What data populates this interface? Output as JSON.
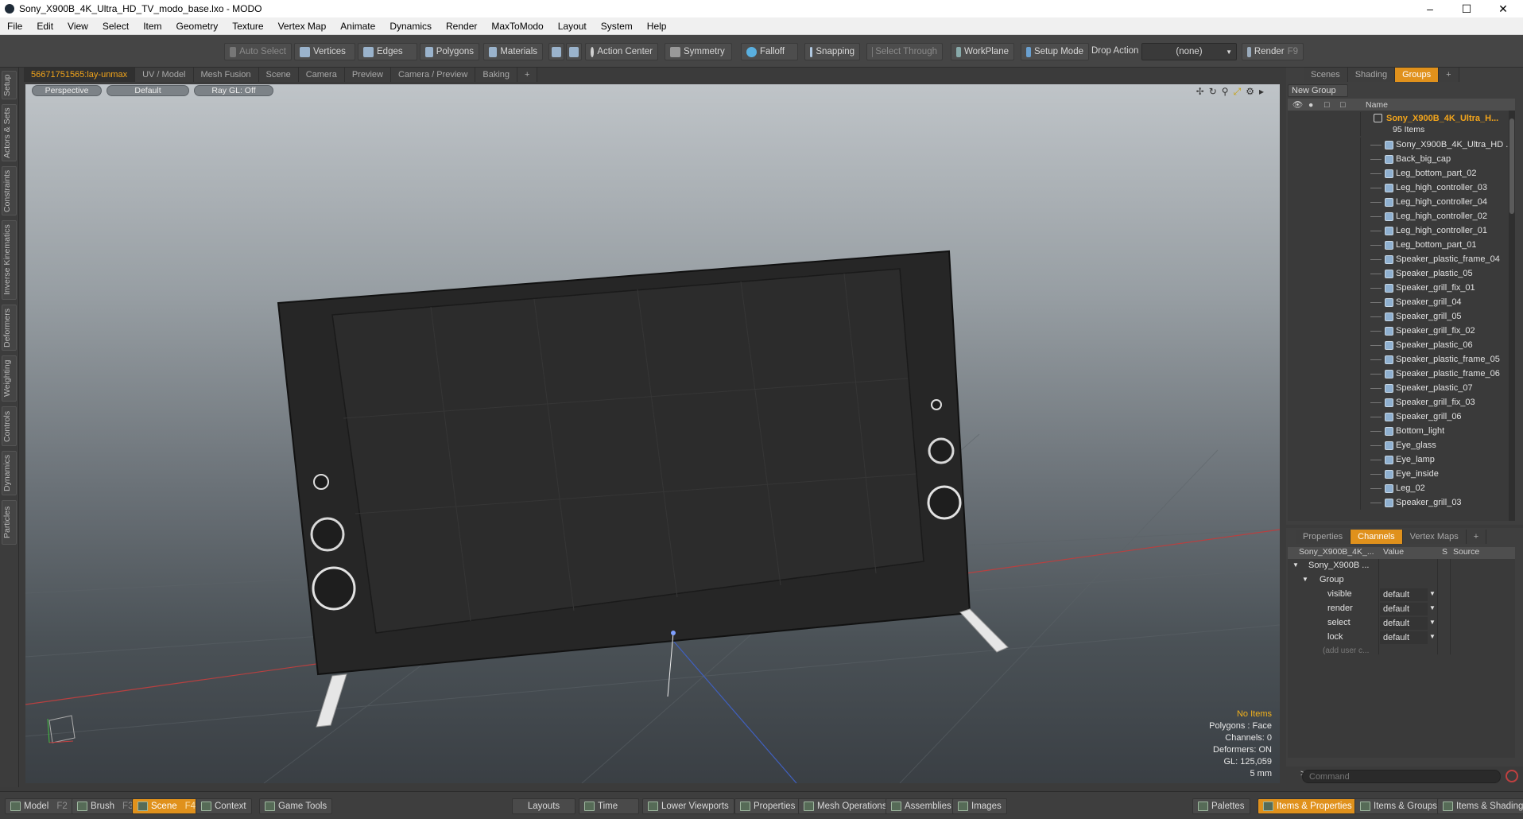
{
  "window": {
    "title": "Sony_X900B_4K_Ultra_HD_TV_modo_base.lxo - MODO",
    "minimize": "–",
    "maximize": "☐",
    "close": "✕"
  },
  "menu": [
    "File",
    "Edit",
    "View",
    "Select",
    "Item",
    "Geometry",
    "Texture",
    "Vertex Map",
    "Animate",
    "Dynamics",
    "Render",
    "MaxToModo",
    "Layout",
    "System",
    "Help"
  ],
  "toolbar": {
    "auto_select": "Auto Select",
    "vertices": "Vertices",
    "edges": "Edges",
    "polygons": "Polygons",
    "materials": "Materials",
    "action_center": "Action Center",
    "symmetry": "Symmetry",
    "falloff": "Falloff",
    "snapping": "Snapping",
    "select_through": "Select Through",
    "workplane": "WorkPlane",
    "setup_mode": "Setup Mode",
    "drop_action": "Drop Action",
    "drop_value": "(none)",
    "render": "Render",
    "render_key": "F9"
  },
  "side_tabs": [
    "Setup",
    "Actors & Sets",
    "Constraints",
    "Inverse Kinematics",
    "Deformers",
    "Weighting",
    "Controls",
    "Dynamics",
    "Particles"
  ],
  "view_tabs": [
    "56671751565:lay-unmax",
    "UV / Model",
    "Mesh Fusion",
    "Scene",
    "Camera",
    "Preview",
    "Camera / Preview",
    "Baking",
    "+"
  ],
  "viewport": {
    "view": "Perspective",
    "shading": "Default",
    "raygl": "Ray GL: Off",
    "info": {
      "selection": "No Items",
      "polygons": "Polygons : Face",
      "channels": "Channels: 0",
      "deformers": "Deformers: ON",
      "gl": "GL: 125,059",
      "scale": "5 mm"
    }
  },
  "scene_tabs": [
    "Scenes",
    "Shading",
    "Groups",
    "+"
  ],
  "groups": {
    "new_group": "New Group",
    "name_col": "Name",
    "root": "Sony_X900B_4K_Ultra_H...",
    "count": "95 Items",
    "items": [
      "Sony_X900B_4K_Ultra_HD ...",
      "Back_big_cap",
      "Leg_bottom_part_02",
      "Leg_high_controller_03",
      "Leg_high_controller_04",
      "Leg_high_controller_02",
      "Leg_high_controller_01",
      "Leg_bottom_part_01",
      "Speaker_plastic_frame_04",
      "Speaker_plastic_05",
      "Speaker_grill_fix_01",
      "Speaker_grill_04",
      "Speaker_grill_05",
      "Speaker_grill_fix_02",
      "Speaker_plastic_06",
      "Speaker_plastic_frame_05",
      "Speaker_plastic_frame_06",
      "Speaker_plastic_07",
      "Speaker_grill_fix_03",
      "Speaker_grill_06",
      "Bottom_light",
      "Eye_glass",
      "Eye_lamp",
      "Eye_inside",
      "Leg_02",
      "Speaker_grill_03"
    ]
  },
  "prop_tabs": [
    "Properties",
    "Channels",
    "Vertex Maps",
    "+"
  ],
  "channels": {
    "col_name": "Sony_X900B_4K_...",
    "col_value": "Value",
    "col_s": "S",
    "col_source": "Source",
    "item": "Sony_X900B ...",
    "group": "Group",
    "rows": [
      {
        "name": "visible",
        "value": "default"
      },
      {
        "name": "render",
        "value": "default"
      },
      {
        "name": "select",
        "value": "default"
      },
      {
        "name": "lock",
        "value": "default"
      }
    ],
    "add_user": "(add user c..."
  },
  "command": {
    "prompt": ">",
    "placeholder": "Command"
  },
  "bottom": {
    "model": "Model",
    "model_key": "F2",
    "brush": "Brush",
    "brush_key": "F3",
    "scene": "Scene",
    "scene_key": "F4",
    "context": "Context",
    "game_tools": "Game Tools",
    "layouts": "Layouts",
    "time": "Time",
    "lower_viewports": "Lower Viewports",
    "properties": "Properties",
    "mesh_operations": "Mesh Operations",
    "assemblies": "Assemblies",
    "images": "Images",
    "palettes": "Palettes",
    "items_properties": "Items & Properties",
    "items_groups": "Items & Groups",
    "items_shading": "Items & Shading"
  },
  "colors": {
    "accent": "#e0911c",
    "highlight": "#f3a51b",
    "panel": "#3f3f3f"
  }
}
